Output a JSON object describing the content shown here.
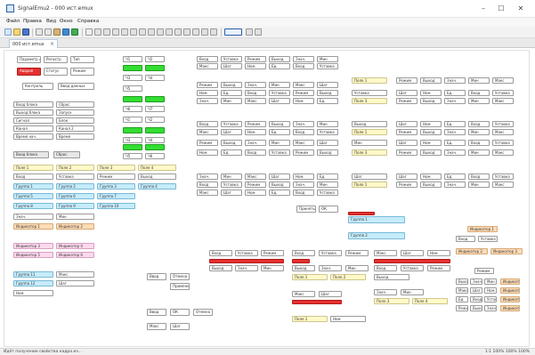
{
  "window": {
    "title": "SignalEmu2 - 000 ист.emux",
    "minimize": "–",
    "maximize": "☐",
    "close": "✕"
  },
  "menu": [
    "Файл",
    "Правка",
    "Вид",
    "Окно",
    "Справка"
  ],
  "tab": {
    "label": "000 ист.emux",
    "close": "×"
  },
  "statusbar": {
    "left": "Идёт получение свойства кадра из...",
    "right": "1:1 100% 100% 100%"
  },
  "colors": {
    "red": "#e53030",
    "green": "#34dd34",
    "cyan": "#c5ecfb",
    "yellow": "#fff9c8",
    "pink": "#fcd9ee",
    "orange": "#fddcb6",
    "accent": "#2b5fa8"
  },
  "toolbar_icons": [
    "new-icon",
    "open-icon",
    "save-icon",
    "cut-icon",
    "copy-icon",
    "paste-icon",
    "undo-icon",
    "redo-icon",
    "settings-icon",
    "play-icon",
    "stop-icon"
  ],
  "canvas": {
    "left_col": [
      {
        "label": "Параметр A",
        "style": "white"
      },
      {
        "label": "Регистр",
        "style": "white"
      },
      {
        "label": "Тип",
        "style": "white"
      },
      {
        "label": "Авария",
        "style": "red"
      },
      {
        "label": "Статус",
        "style": "white"
      },
      {
        "label": "Режим",
        "style": "white"
      },
      {
        "label": "Контроль",
        "style": "white"
      },
      {
        "label": "Ввод данных",
        "style": "white"
      },
      {
        "label": "Вход блока",
        "style": "white"
      },
      {
        "label": "Сброс",
        "style": "white"
      },
      {
        "label": "Выход блока",
        "style": "white"
      },
      {
        "label": "Запуск",
        "style": "white"
      },
      {
        "label": "Сигнал",
        "style": "white"
      },
      {
        "label": "Блок",
        "style": "white"
      },
      {
        "label": "Канал",
        "style": "white"
      },
      {
        "label": "Канал 2",
        "style": "white"
      },
      {
        "label": "Время нач.",
        "style": "white"
      },
      {
        "label": "Время",
        "style": "white"
      }
    ],
    "cyan_rows": [
      "Группа 1",
      "Группа 2",
      "Группа 3",
      "Группа 4",
      "Группа 5",
      "Группа 6",
      "Группа 7",
      "Группа 8",
      "Группа 9",
      "Группа 10",
      "Группа 11",
      "Группа 12"
    ],
    "yellow_rows": [
      "Поле 1",
      "Поле 2",
      "Поле 3",
      "Поле 4"
    ],
    "pink_rows": [
      "Индикатор 1",
      "Индикатор 2",
      "Индикатор 3",
      "Индикатор 4",
      "Индикатор 5",
      "Индикатор 6"
    ],
    "green_col": [
      "Ч1",
      "Ч2",
      "Ч3",
      "Ч4",
      "Ч5",
      "Ч6",
      "Ч7"
    ],
    "grid_labels": [
      "Вход",
      "Уставка",
      "Режим",
      "Выход",
      "Знач.",
      "Мин",
      "Макс",
      "Шаг",
      "Ном",
      "Ед."
    ],
    "buttons": {
      "accept": "Принять",
      "ok": "ОК",
      "cancel": "Отмена",
      "apply": "Применить",
      "enter": "Ввод"
    }
  }
}
